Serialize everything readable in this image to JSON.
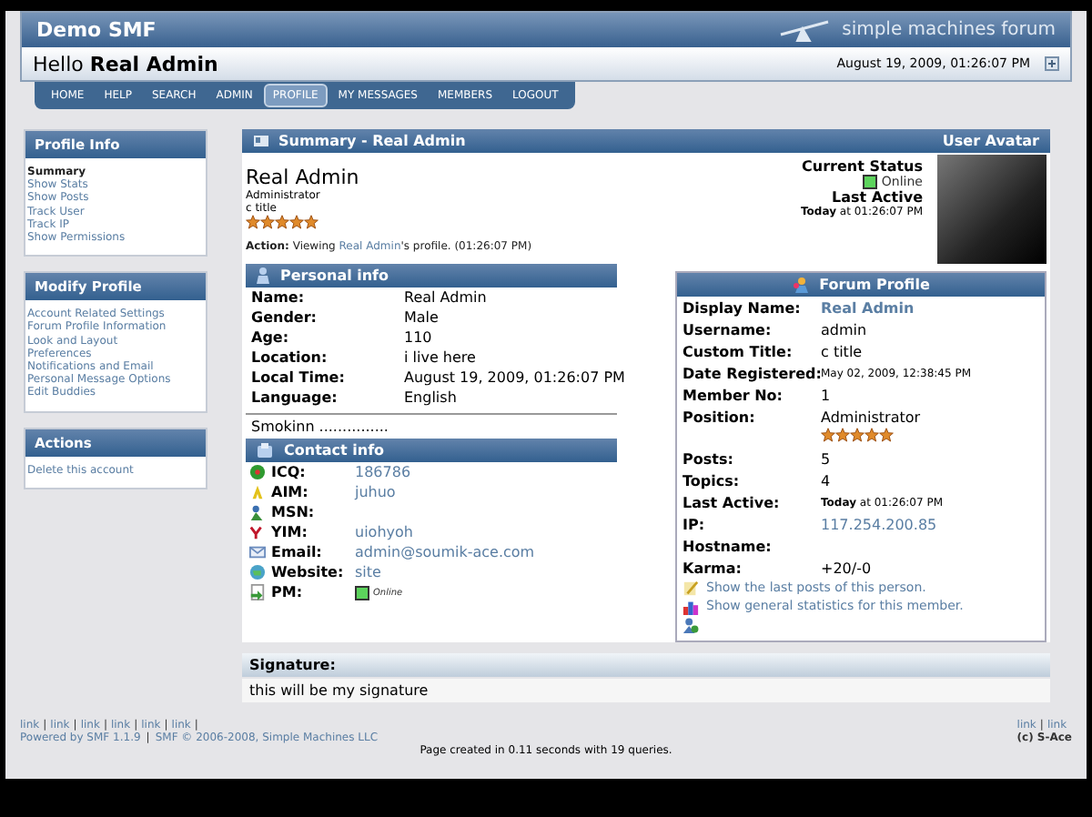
{
  "header": {
    "site_title": "Demo SMF",
    "logo_text": "simple machines forum",
    "greeting": "Hello",
    "user": "Real Admin",
    "datetime": "August 19, 2009, 01:26:07 PM"
  },
  "menu": [
    {
      "label": "HOME",
      "selected": false
    },
    {
      "label": "HELP",
      "selected": false
    },
    {
      "label": "SEARCH",
      "selected": false
    },
    {
      "label": "ADMIN",
      "selected": false
    },
    {
      "label": "PROFILE",
      "selected": true
    },
    {
      "label": "MY MESSAGES",
      "selected": false
    },
    {
      "label": "MEMBERS",
      "selected": false
    },
    {
      "label": "LOGOUT",
      "selected": false
    }
  ],
  "sidebar": [
    {
      "title": "Profile Info",
      "items": [
        {
          "label": "Summary",
          "selected": true
        },
        {
          "label": "Show Stats",
          "selected": false
        },
        {
          "label": "Show Posts",
          "selected": false
        },
        {
          "label": "Track User",
          "selected": false
        },
        {
          "label": "Track IP",
          "selected": false
        },
        {
          "label": "Show Permissions",
          "selected": false
        }
      ]
    },
    {
      "title": "Modify Profile",
      "items": [
        {
          "label": "Account Related Settings",
          "selected": false
        },
        {
          "label": "Forum Profile Information",
          "selected": false
        },
        {
          "label": "Look and Layout",
          "selected": false
        },
        {
          "label": "Preferences",
          "selected": false
        },
        {
          "label": "Notifications and Email",
          "selected": false
        },
        {
          "label": "Personal Message Options",
          "selected": false
        },
        {
          "label": "Edit Buddies",
          "selected": false
        }
      ]
    },
    {
      "title": "Actions",
      "items": [
        {
          "label": "Delete this account",
          "selected": false
        }
      ]
    }
  ],
  "summary": {
    "title": "Summary - Real Admin",
    "avatar_title": "User Avatar",
    "name": "Real Admin",
    "group": "Administrator",
    "custom_title": "c title",
    "stars": 5,
    "action_label": "Action:",
    "action_text": "Viewing ",
    "action_link": "Real Admin",
    "action_suffix": "'s profile. (01:26:07 PM)",
    "status_label": "Current Status",
    "online": true,
    "status": "Online",
    "last_active_label": "Last Active",
    "last_active": "**Today** at 01:26:07 PM"
  },
  "personal": {
    "title": "Personal info",
    "rows": [
      {
        "label": "Name:",
        "value": "Real Admin"
      },
      {
        "label": "Gender:",
        "value": "Male"
      },
      {
        "label": "Age:",
        "value": "110"
      },
      {
        "label": "Location:",
        "value": "i live here"
      },
      {
        "label": "Local Time:",
        "value": "August 19, 2009, 01:26:07 PM"
      },
      {
        "label": "Language:",
        "value": "English"
      }
    ],
    "signature_line": "Smokinn ..............."
  },
  "contact": {
    "title": "Contact info",
    "rows": [
      {
        "kind": "icq",
        "label": "ICQ:",
        "value": "186786"
      },
      {
        "kind": "aim",
        "label": "AIM:",
        "value": "juhuo"
      },
      {
        "kind": "msn",
        "label": "MSN:"
      },
      {
        "kind": "yim",
        "label": "YIM:",
        "value": "uiohyoh"
      },
      {
        "kind": "email",
        "label": "Email:",
        "value": "admin@soumik-ace.com"
      },
      {
        "kind": "website",
        "label": "Website:",
        "value": "site"
      },
      {
        "kind": "pm",
        "label": "PM:",
        "value": "Online",
        "online": true
      }
    ]
  },
  "forum": {
    "title": "Forum Profile",
    "rows": [
      {
        "kind": "link",
        "label": "Display Name:",
        "value": "Real Admin"
      },
      {
        "kind": "text",
        "label": "Username:",
        "value": "admin"
      },
      {
        "kind": "text",
        "label": "Custom Title:",
        "value": "c title"
      },
      {
        "kind": "small",
        "label": "Date Registered:",
        "value": "May 02, 2009, 12:38:45 PM"
      },
      {
        "kind": "text",
        "label": "Member No:",
        "value": "1"
      },
      {
        "kind": "text",
        "label": "Position:",
        "value": "Administrator",
        "stars": 5
      },
      {
        "kind": "text",
        "label": "Posts:",
        "value": "5"
      },
      {
        "kind": "text",
        "label": "Topics:",
        "value": "4"
      },
      {
        "kind": "small",
        "label": "Last Active:",
        "value": "**Today** at 01:26:07 PM"
      },
      {
        "kind": "link",
        "label": "IP:",
        "value": "117.254.200.85"
      },
      {
        "label": "Hostname:"
      },
      {
        "kind": "text",
        "label": "Karma:",
        "value": "+20/-0"
      }
    ],
    "links": [
      {
        "kind": "posts",
        "label": "Show the last posts of this person."
      },
      {
        "kind": "stats",
        "label": "Show general statistics for this member."
      },
      {
        "kind": "buddy"
      }
    ]
  },
  "signature": {
    "label": "Signature:",
    "text": "this will be my signature"
  },
  "footer": {
    "left_links": [
      "link",
      "link",
      "link",
      "link",
      "link",
      "link"
    ],
    "right_links": [
      "link",
      "link"
    ],
    "separator": "|",
    "powered": "Powered by SMF 1.1.9",
    "copyright": "SMF © 2006-2008, Simple Machines LLC",
    "credit": "(c) S-Ace",
    "page_created": "Page created in 0.11 seconds with 19 queries."
  }
}
